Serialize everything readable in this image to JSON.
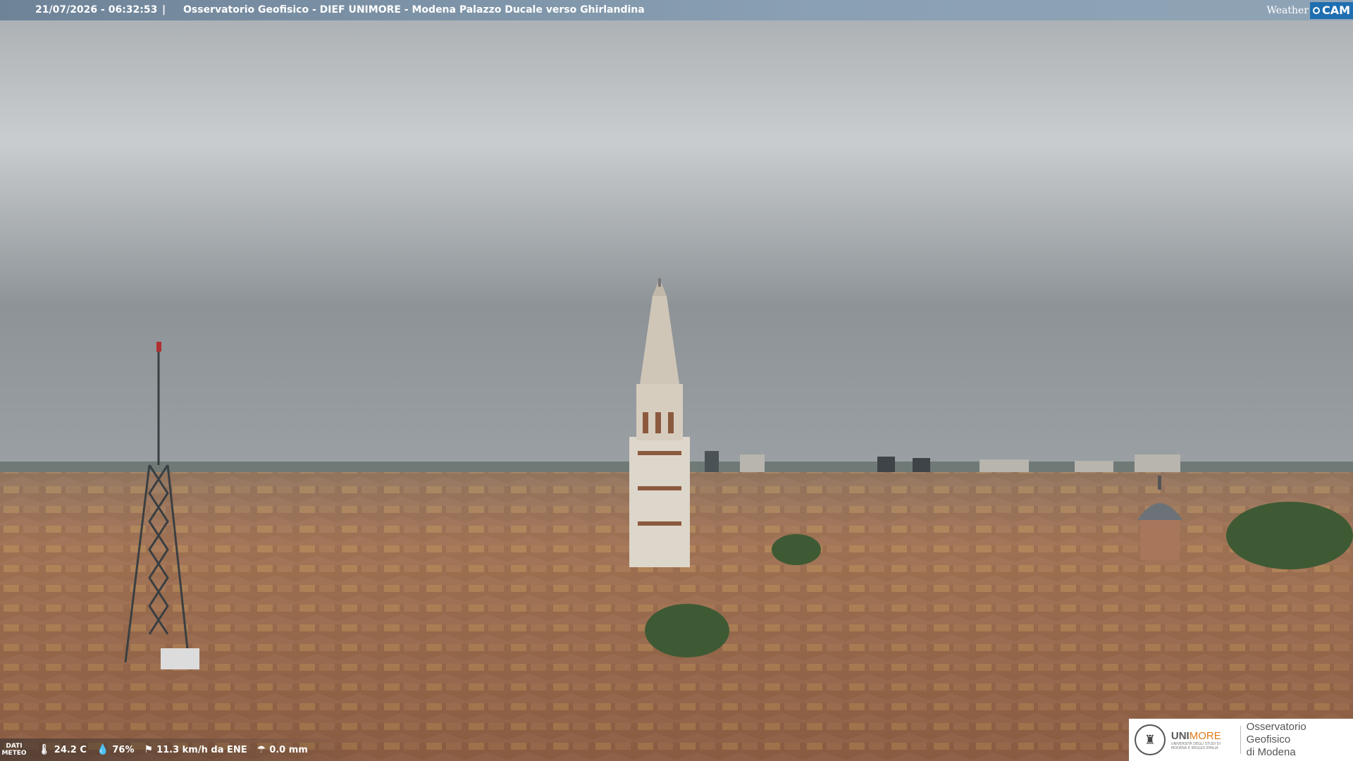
{
  "header": {
    "timestamp": "21/07/2026 - 06:32:53",
    "separator": "|",
    "title": "Osservatorio Geofisico - DIEF UNIMORE - Modena Palazzo Ducale verso Ghirlandina"
  },
  "brand": {
    "weather": "Weather",
    "cam": "CAM"
  },
  "meteo": {
    "label_line1": "DATI",
    "label_line2": "METEO",
    "temperature": "24.2 C",
    "humidity": "76%",
    "wind": "11.3 km/h da ENE",
    "rain": "0.0 mm",
    "icons": [
      "thermometer-icon",
      "humidity-icon",
      "wind-icon",
      "rain-icon"
    ]
  },
  "institution": {
    "name_prefix": "UNI",
    "name_suffix": "MORE",
    "sub_line1": "UNIVERSITÀ DEGLI STUDI DI",
    "sub_line2": "MODENA E REGGIO EMILIA",
    "obs_line1": "Osservatorio Geofisico",
    "obs_line2": "di Modena"
  },
  "colors": {
    "accent": "#1f6fb0",
    "unimore_orange": "#e07a1a",
    "sky": "#8c9297",
    "roofs": "#9a6a4e"
  }
}
